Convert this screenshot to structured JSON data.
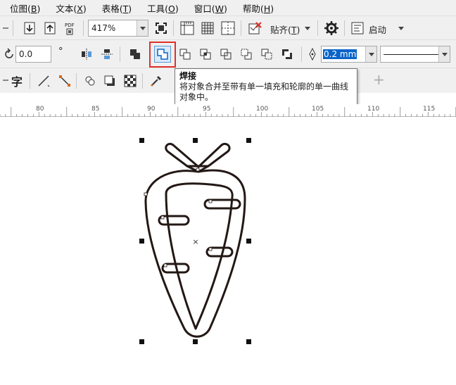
{
  "menu": {
    "items": [
      {
        "label": "位图(",
        "accel": "B",
        "end": ")"
      },
      {
        "label": "文本(",
        "accel": "X",
        "end": ")"
      },
      {
        "label": "表格(",
        "accel": "T",
        "end": ")"
      },
      {
        "label": "工具(",
        "accel": "O",
        "end": ")"
      },
      {
        "label": "窗口(",
        "accel": "W",
        "end": ")"
      },
      {
        "label": "帮助(",
        "accel": "H",
        "end": ")"
      }
    ]
  },
  "toolbar1": {
    "zoom_value": "417%",
    "pdf_label": "PDF",
    "snap_label": "贴齐(",
    "snap_accel": "T",
    "snap_end": ")",
    "launch_label": "启动"
  },
  "toolbar2": {
    "angle_value": "0.0",
    "degree_symbol": "°",
    "outline_width": "0.2 mm"
  },
  "toolbar3": {
    "text_tool_glyph": "字",
    "add_label": "+"
  },
  "tooltip": {
    "title": "焊接",
    "description": "将对象合并至带有单一填充和轮廓的单一曲线对象中。"
  },
  "ruler": {
    "labels": [
      "80",
      "85",
      "90",
      "95",
      "100",
      "105",
      "110",
      "115"
    ]
  },
  "canvas": {
    "center_mark": "×"
  },
  "colors": {
    "accent_highlight": "#e0302a",
    "selection_blue": "#0a64c8",
    "shape_stroke": "#231815"
  },
  "icons": [
    "import-icon",
    "export-icon",
    "publish-pdf-icon",
    "full-screen-icon",
    "rulers-icon",
    "grid-icon",
    "guidelines-icon",
    "snap-off-icon",
    "options-gear-icon",
    "launch-icon",
    "rotate-icon",
    "mirror-horizontal-icon",
    "mirror-vertical-icon",
    "combine-icon",
    "weld-icon",
    "trim-icon",
    "intersect-icon",
    "simplify-icon",
    "front-minus-back-icon",
    "back-minus-front-icon",
    "boundary-icon",
    "pen-outline-icon",
    "text-icon",
    "line-icon",
    "connector-icon",
    "effects-icon",
    "drop-shadow-icon",
    "transparency-icon",
    "eyedropper-icon",
    "add-icon"
  ]
}
